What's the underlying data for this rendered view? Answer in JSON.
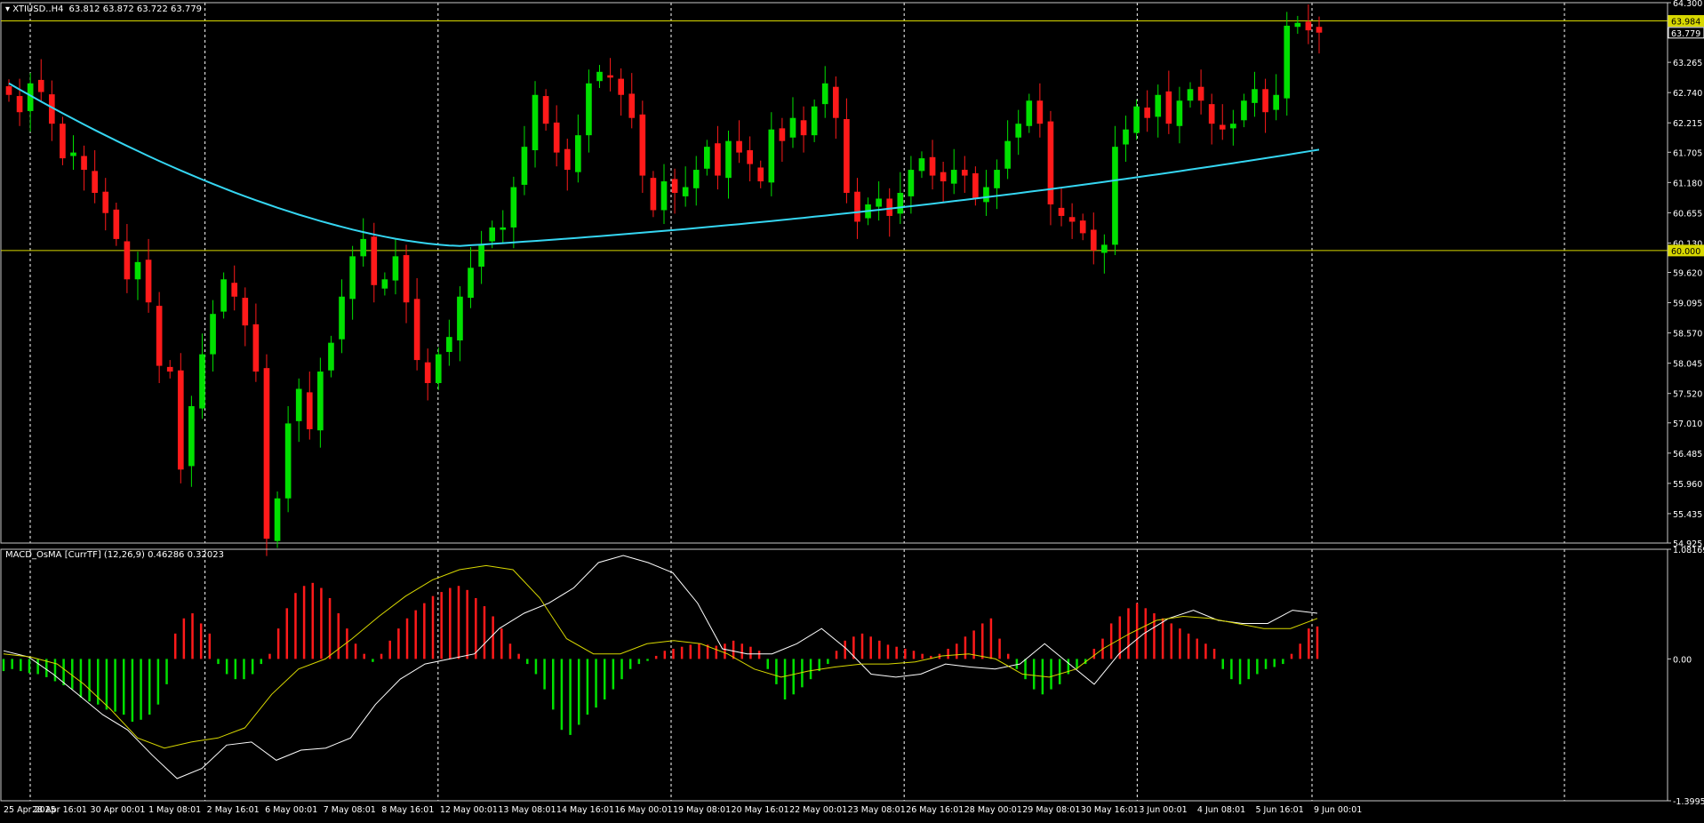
{
  "header": {
    "symbol": "XTIUSD..H4",
    "ohlc": "63.812 63.872 63.722 63.779"
  },
  "indicator": {
    "label": "MACD_OsMA [CurrTF] (12,26,9) 0.46286 0.32023"
  },
  "colors": {
    "background": "#000000",
    "bull": "#00e000",
    "bear": "#ff1a1a",
    "ma": "#35d6f2",
    "hline": "#d8d800",
    "grid": "#ffffff",
    "frame": "#c8c8c8",
    "macd": "#ffffff",
    "signal": "#d8d800"
  },
  "chart_data": [
    {
      "type": "candlestick",
      "panel": "price",
      "ylim": [
        54.925,
        64.3
      ],
      "ytick_labels": [
        "64.300",
        "63.265",
        "62.740",
        "62.215",
        "61.705",
        "61.180",
        "60.655",
        "60.130",
        "59.620",
        "59.095",
        "58.570",
        "58.045",
        "57.520",
        "57.010",
        "56.485",
        "55.960",
        "55.435",
        "54.925"
      ],
      "ytick_values": [
        64.3,
        63.265,
        62.74,
        62.215,
        61.705,
        61.18,
        60.655,
        60.13,
        59.62,
        59.095,
        58.57,
        58.045,
        57.52,
        57.01,
        56.485,
        55.96,
        55.435,
        54.925
      ],
      "price_tags": [
        {
          "label": "63.984",
          "value": 63.984,
          "style": "yellow"
        },
        {
          "label": "63.779",
          "value": 63.779,
          "style": "white"
        },
        {
          "label": "60.000",
          "value": 60.0,
          "style": "yellow"
        }
      ],
      "horizontal_lines": [
        63.984,
        60.0
      ],
      "x_labels": [
        "25 Apr 2025",
        "28 Apr 16:01",
        "30 Apr 00:01",
        "1 May 08:01",
        "2 May 16:01",
        "6 May 00:01",
        "7 May 08:01",
        "8 May 16:01",
        "12 May 00:01",
        "13 May 08:01",
        "14 May 16:01",
        "16 May 00:01",
        "19 May 08:01",
        "20 May 16:01",
        "22 May 00:01",
        "23 May 08:01",
        "26 May 16:01",
        "28 May 00:01",
        "29 May 08:01",
        "30 May 16:01",
        "3 Jun 00:01",
        "4 Jun 08:01",
        "5 Jun 16:01",
        "9 Jun 00:01"
      ],
      "closes": [
        62.7,
        62.4,
        62.9,
        62.75,
        62.2,
        61.6,
        61.7,
        61.4,
        61.0,
        60.65,
        60.2,
        59.5,
        59.8,
        59.1,
        58.0,
        57.9,
        56.2,
        57.3,
        58.2,
        58.9,
        59.5,
        59.2,
        58.7,
        57.9,
        55.0,
        55.7,
        57.0,
        57.6,
        56.9,
        57.9,
        58.4,
        59.2,
        59.9,
        60.2,
        59.4,
        59.5,
        59.9,
        59.1,
        58.1,
        57.7,
        58.2,
        58.5,
        59.2,
        59.7,
        60.1,
        60.4,
        60.4,
        61.1,
        61.8,
        62.7,
        62.2,
        61.7,
        61.4,
        62.0,
        62.9,
        63.1,
        63.0,
        62.7,
        62.3,
        61.3,
        60.7,
        61.2,
        61.0,
        61.1,
        61.4,
        61.8,
        61.3,
        61.9,
        61.7,
        61.5,
        61.2,
        62.1,
        61.9,
        62.3,
        62.0,
        62.5,
        62.9,
        62.3,
        61.0,
        60.5,
        60.8,
        60.9,
        60.6,
        61.0,
        61.4,
        61.6,
        61.3,
        61.2,
        61.4,
        61.3,
        60.9,
        61.1,
        61.4,
        61.9,
        62.2,
        62.6,
        62.2,
        60.8,
        60.6,
        60.5,
        60.3,
        60.0,
        60.1,
        61.8,
        62.1,
        62.5,
        62.3,
        62.7,
        62.2,
        62.6,
        62.8,
        62.6,
        62.2,
        62.1,
        62.2,
        62.6,
        62.8,
        62.4,
        62.7,
        63.9,
        63.95,
        63.82,
        63.78
      ],
      "moving_average": {
        "period": 200,
        "start": 62.9,
        "min": 60.08,
        "end": 61.75
      }
    },
    {
      "type": "histogram_with_lines",
      "panel": "indicator",
      "ylim": [
        -1.39953,
        1.08169
      ],
      "ytick_labels": [
        "1.08169",
        "0.00",
        "-1.39953"
      ],
      "ytick_values": [
        1.08169,
        0.0,
        -1.39953
      ],
      "series": [
        {
          "type": "bar",
          "values": [
            -0.12,
            -0.1,
            -0.12,
            -0.14,
            -0.15,
            -0.18,
            -0.22,
            -0.26,
            -0.3,
            -0.38,
            -0.42,
            -0.45,
            -0.5,
            -0.52,
            -0.55,
            -0.62,
            -0.6,
            -0.55,
            -0.45,
            -0.25,
            0.25,
            0.4,
            0.45,
            0.35,
            0.25,
            -0.05,
            -0.15,
            -0.2,
            -0.2,
            -0.15,
            -0.05,
            0.05,
            0.3,
            0.5,
            0.65,
            0.72,
            0.75,
            0.7,
            0.6,
            0.45,
            0.3,
            0.15,
            0.05,
            -0.03,
            0.05,
            0.18,
            0.3,
            0.4,
            0.48,
            0.55,
            0.62,
            0.66,
            0.7,
            0.72,
            0.68,
            0.6,
            0.52,
            0.42,
            0.3,
            0.15,
            0.05,
            -0.05,
            -0.15,
            -0.3,
            -0.5,
            -0.7,
            -0.75,
            -0.65,
            -0.55,
            -0.48,
            -0.4,
            -0.3,
            -0.2,
            -0.1,
            -0.05,
            -0.02,
            0.03,
            0.08,
            0.1,
            0.12,
            0.14,
            0.15,
            0.14,
            0.13,
            0.15,
            0.18,
            0.15,
            0.12,
            0.08,
            -0.1,
            -0.25,
            -0.4,
            -0.35,
            -0.28,
            -0.2,
            -0.12,
            -0.05,
            0.08,
            0.18,
            0.22,
            0.25,
            0.22,
            0.18,
            0.14,
            0.12,
            0.1,
            0.08,
            0.05,
            0.03,
            0.05,
            0.1,
            0.15,
            0.22,
            0.28,
            0.35,
            0.4,
            0.2,
            0.05,
            -0.1,
            -0.2,
            -0.3,
            -0.35,
            -0.3,
            -0.25,
            -0.15,
            -0.1,
            -0.05,
            0.1,
            0.2,
            0.35,
            0.42,
            0.5,
            0.55,
            0.5,
            0.45,
            0.4,
            0.35,
            0.3,
            0.25,
            0.2,
            0.15,
            0.1,
            -0.1,
            -0.2,
            -0.25,
            -0.2,
            -0.15,
            -0.1,
            -0.08,
            -0.05,
            0.05,
            0.15,
            0.3,
            0.32
          ]
        },
        {
          "type": "line",
          "role": "macd",
          "values": [
            0.08,
            0.02,
            -0.15,
            -0.35,
            -0.55,
            -0.7,
            -0.95,
            -1.18,
            -1.08,
            -0.85,
            -0.82,
            -1.0,
            -0.9,
            -0.88,
            -0.78,
            -0.45,
            -0.2,
            -0.05,
            0.0,
            0.05,
            0.3,
            0.45,
            0.55,
            0.7,
            0.95,
            1.02,
            0.95,
            0.85,
            0.55,
            0.1,
            0.05,
            0.05,
            0.15,
            0.3,
            0.1,
            -0.15,
            -0.18,
            -0.15,
            -0.05,
            -0.08,
            -0.1,
            -0.05,
            0.15,
            -0.05,
            -0.25,
            0.05,
            0.25,
            0.4,
            0.48,
            0.38,
            0.35,
            0.35,
            0.48,
            0.45
          ]
        },
        {
          "type": "line",
          "role": "signal",
          "values": [
            0.05,
            0.02,
            -0.05,
            -0.25,
            -0.5,
            -0.78,
            -0.88,
            -0.82,
            -0.78,
            -0.68,
            -0.35,
            -0.1,
            0.0,
            0.2,
            0.42,
            0.62,
            0.78,
            0.88,
            0.92,
            0.88,
            0.6,
            0.2,
            0.05,
            0.05,
            0.15,
            0.18,
            0.15,
            0.05,
            -0.1,
            -0.18,
            -0.12,
            -0.08,
            -0.05,
            -0.05,
            -0.03,
            0.03,
            0.05,
            0.0,
            -0.15,
            -0.18,
            -0.1,
            0.1,
            0.25,
            0.38,
            0.42,
            0.4,
            0.35,
            0.3,
            0.3,
            0.4
          ]
        }
      ]
    }
  ]
}
